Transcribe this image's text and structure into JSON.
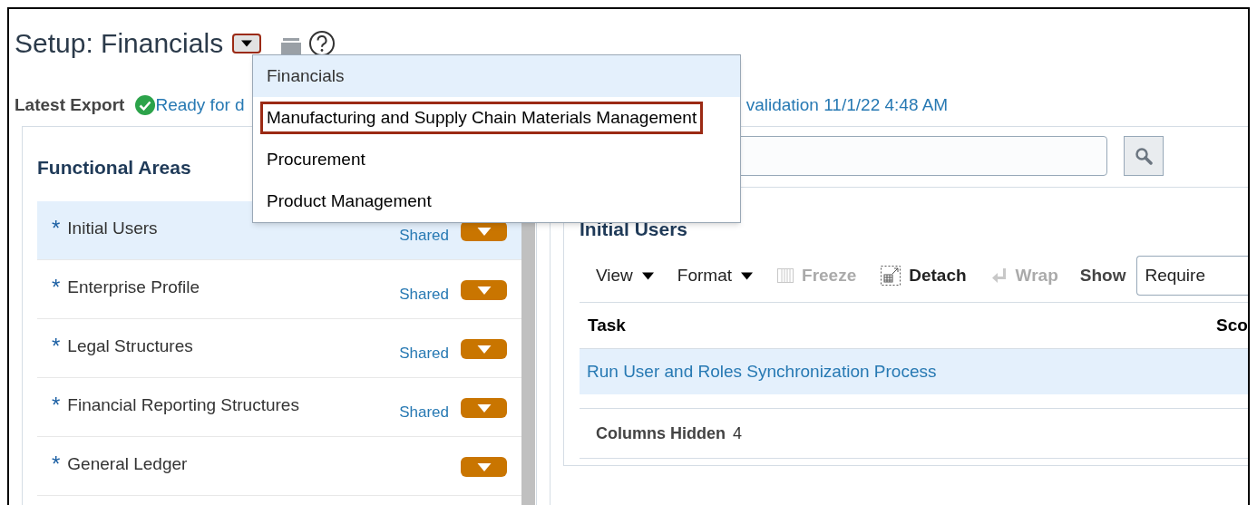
{
  "header": {
    "title": "Setup: Financials",
    "title_menu_open": true,
    "title_menu_outlined": true
  },
  "offering_menu": [
    {
      "label": "Financials",
      "selected": true,
      "outlined": false
    },
    {
      "label": "Manufacturing and Supply Chain Materials Management",
      "selected": false,
      "outlined": true
    },
    {
      "label": "Procurement",
      "selected": false,
      "outlined": false
    },
    {
      "label": "Product Management",
      "selected": false,
      "outlined": false
    }
  ],
  "export": {
    "label": "Latest Export",
    "status_start": "Ready for d",
    "status_end": "validation 11/1/22 4:48 AM"
  },
  "functional_areas": {
    "title": "Functional Areas",
    "items": [
      {
        "label": "Initial Users",
        "marker": "*",
        "badge": "Shared",
        "selected": true
      },
      {
        "label": "Enterprise Profile",
        "marker": "*",
        "badge": "Shared",
        "selected": false
      },
      {
        "label": "Legal Structures",
        "marker": "*",
        "badge": "Shared",
        "selected": false
      },
      {
        "label": "Financial Reporting Structures",
        "marker": "*",
        "badge": "Shared",
        "selected": false
      },
      {
        "label": "General Ledger",
        "marker": "*",
        "selected": false
      }
    ]
  },
  "tasks": {
    "title": "Initial Users",
    "toolbar": [
      {
        "kind": "menu",
        "label": "View",
        "disabled": false
      },
      {
        "kind": "menu",
        "label": "Format",
        "disabled": false
      },
      {
        "kind": "freeze",
        "label": "Freeze",
        "disabled": true
      },
      {
        "kind": "detach",
        "label": "Detach",
        "disabled": false
      },
      {
        "kind": "wrap",
        "label": "Wrap",
        "disabled": true
      }
    ],
    "show_label": "Show",
    "show_value": "Require",
    "columns": [
      "Task",
      "Sco"
    ],
    "rows": [
      {
        "task": "Run User and Roles Synchronization Process",
        "selected": true
      }
    ],
    "columns_hidden_label": "Columns Hidden",
    "columns_hidden_count": "4"
  }
}
